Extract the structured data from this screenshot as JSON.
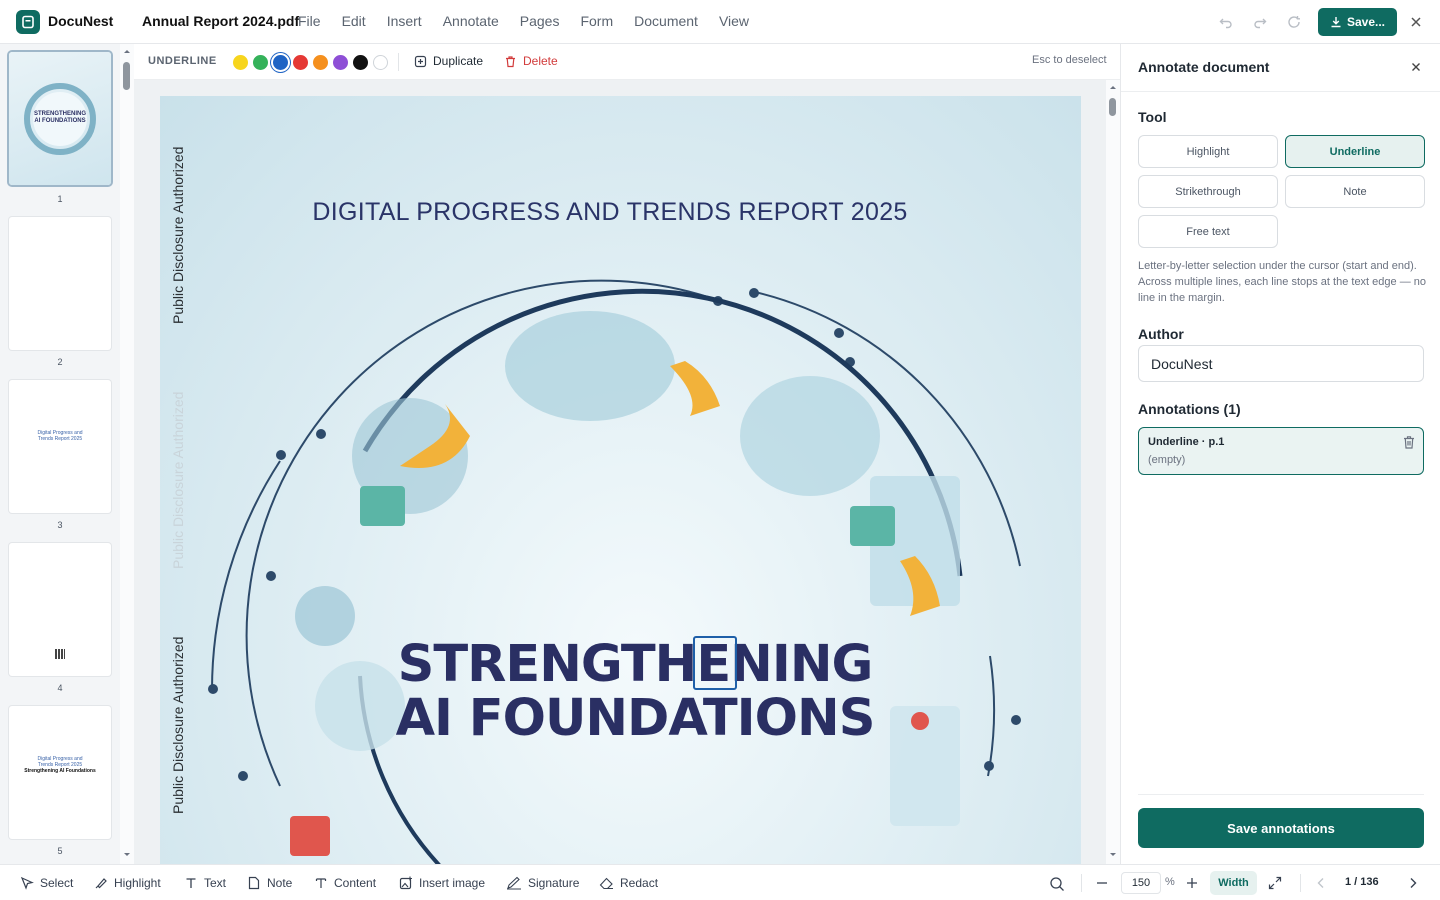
{
  "app": {
    "name": "DocuNest",
    "file_name": "Annual Report 2024.pdf"
  },
  "menu": [
    "File",
    "Edit",
    "Insert",
    "Annotate",
    "Pages",
    "Form",
    "Document",
    "View"
  ],
  "top_actions": {
    "save_label": "Save..."
  },
  "annotation_toolbar": {
    "mode_label": "UNDERLINE",
    "colors": [
      "#f7d51d",
      "#35b25a",
      "#1e63c4",
      "#e53935",
      "#f5901e",
      "#8e4fd6",
      "#111111",
      "#ffffff"
    ],
    "selected_color": "#1e63c4",
    "duplicate_label": "Duplicate",
    "delete_label": "Delete",
    "esc_hint": "Esc to deselect"
  },
  "thumbnails": [
    {
      "num": "1",
      "active": true,
      "lines": [
        "STRENGTHENING",
        "AI FOUNDATIONS"
      ]
    },
    {
      "num": "2",
      "active": false,
      "lines": []
    },
    {
      "num": "3",
      "active": false,
      "lines": [
        "Digital Progress and",
        "Trends Report 2025"
      ]
    },
    {
      "num": "4",
      "active": false,
      "lines": []
    },
    {
      "num": "5",
      "active": false,
      "lines": [
        "Digital Progress and",
        "Trends Report 2025",
        "Strengthening AI Foundations"
      ]
    }
  ],
  "document": {
    "side_stamp": "Public Disclosure Authorized",
    "report_title": "DIGITAL PROGRESS AND TRENDS REPORT 2025",
    "title_line1": "STRENGTHENING",
    "title_line2": "AI FOUNDATIONS"
  },
  "panel": {
    "title": "Annotate document",
    "tool_label": "Tool",
    "tools": [
      "Highlight",
      "Underline",
      "Strikethrough",
      "Note",
      "Free text"
    ],
    "active_tool": "Underline",
    "help": "Letter-by-letter selection under the cursor (start and end). Across multiple lines, each line stops at the text edge — no line in the margin.",
    "author_label": "Author",
    "author_value": "DocuNest",
    "annotations_label": "Annotations (1)",
    "annotations": [
      {
        "title": "Underline · p.1",
        "body": "(empty)"
      }
    ],
    "save_label": "Save annotations"
  },
  "bottom_tools": [
    "Select",
    "Highlight",
    "Text",
    "Note",
    "Content",
    "Insert image",
    "Signature",
    "Redact"
  ],
  "zoom": {
    "value": "150",
    "unit": "%",
    "fit_label": "Width"
  },
  "pagination": {
    "indicator": "1 / 136"
  }
}
